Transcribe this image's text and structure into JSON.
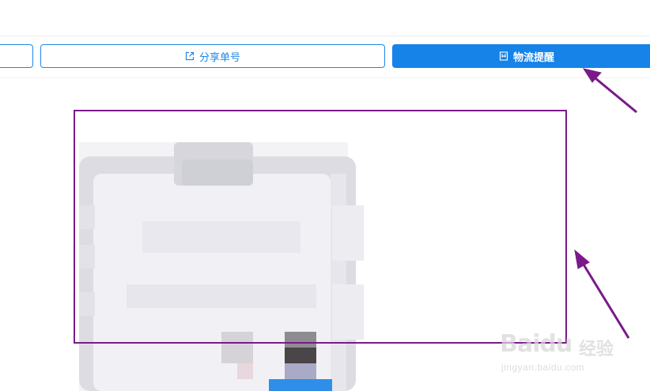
{
  "toolbar": {
    "share_label": "分享单号",
    "remind_label": "物流提醒"
  },
  "watermark": {
    "logo_text": "Baidu",
    "logo_suffix": "经验",
    "url": "jingyan.baidu.com"
  },
  "colors": {
    "accent": "#1583e8",
    "outline": "#1e88e5",
    "annotation": "#7a1a8a"
  },
  "icons": {
    "share": "external-link-icon",
    "remind": "bookmark-icon",
    "illustration": "clipboard-icon"
  }
}
